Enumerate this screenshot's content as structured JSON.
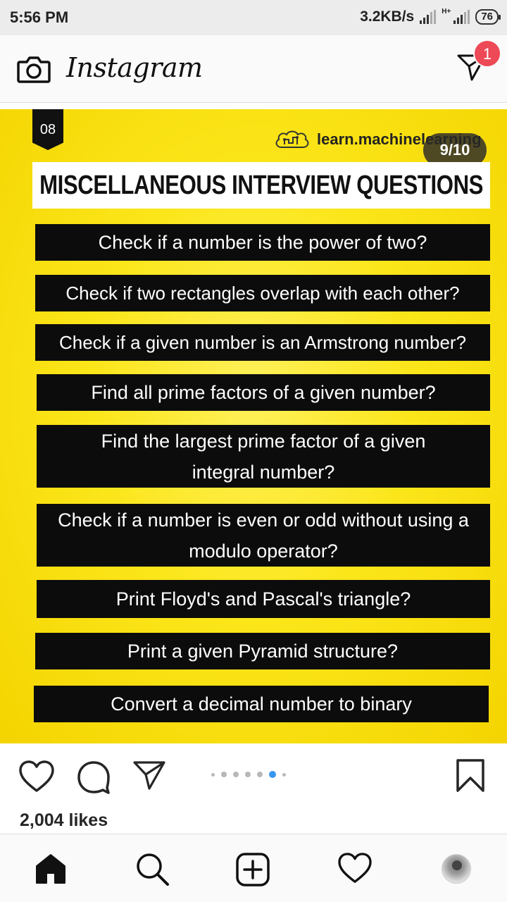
{
  "status_bar": {
    "time": "5:56 PM",
    "net_speed": "3.2KB/s",
    "network_type": "H+",
    "battery": "76"
  },
  "header": {
    "app_name": "Instagram",
    "dm_badge": "1",
    "icons": [
      "camera-icon",
      "direct-message-icon"
    ]
  },
  "post": {
    "slide_tag": "08",
    "brand": "learn.machinelearning",
    "slide_counter": "9/10",
    "title": "MISCELLANEOUS INTERVIEW QUESTIONS",
    "questions": [
      "Check if a number is the power of two?",
      "Check if two rectangles overlap with each other?",
      "Check if a given number is an Armstrong number?",
      "Find all prime factors of a given number?",
      "Find the largest prime factor of a given integral number?",
      "Check if a number is even or odd without using a modulo operator?",
      "Print Floyd's and Pascal's triangle?",
      "Print a given Pyramid structure?",
      "Convert a decimal number to binary"
    ],
    "colors": {
      "background": "#fbe61a",
      "box": "#0c0c0c",
      "box_text": "#ffffff"
    }
  },
  "actions": {
    "likes": "2,004 likes",
    "carousel_total": 10,
    "carousel_active": 9,
    "active_dot_color": "#3897f0",
    "icons": [
      "heart-icon",
      "comment-icon",
      "share-icon",
      "bookmark-icon"
    ]
  },
  "bottom_nav": {
    "items": [
      "home-icon",
      "search-icon",
      "add-post-icon",
      "activity-heart-icon",
      "profile-avatar"
    ]
  }
}
